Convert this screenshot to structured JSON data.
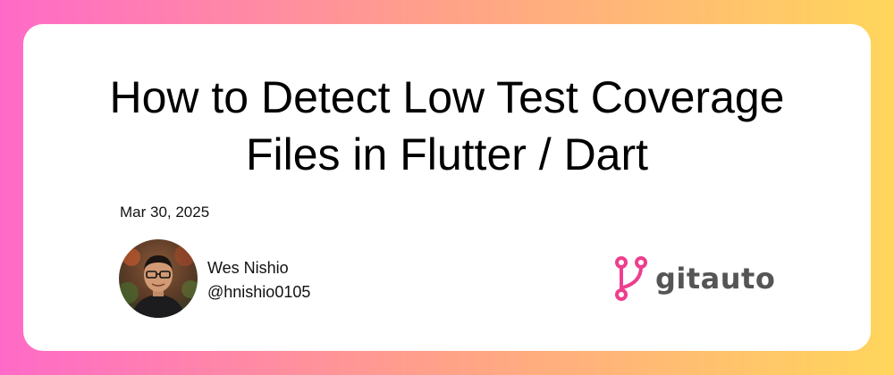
{
  "title": {
    "line1": "How to Detect Low Test Coverage",
    "line2": "Files in Flutter / Dart"
  },
  "date": "Mar 30, 2025",
  "author": {
    "name": "Wes Nishio",
    "handle": "@hnishio0105"
  },
  "brand": {
    "name": "gitauto",
    "icon": "git-branch-icon",
    "icon_color": "#ee3e8e",
    "text_color": "#555555"
  },
  "colors": {
    "gradient_start": "#ff6ac8",
    "gradient_mid": "#ffa08a",
    "gradient_end": "#ffd65c"
  }
}
